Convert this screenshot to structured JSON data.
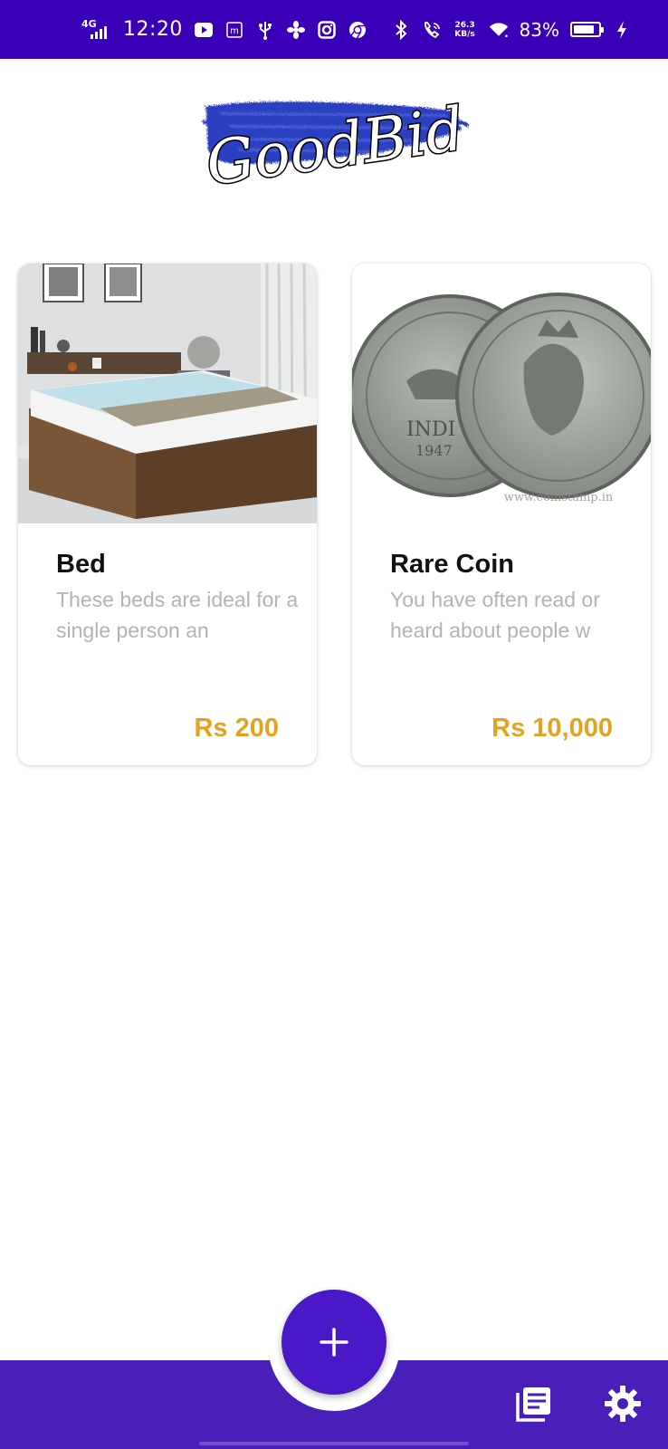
{
  "status_bar": {
    "network": "4G",
    "time": "12:20",
    "speed_value": "26.3",
    "speed_unit": "KB/s",
    "battery_percent": "83%",
    "battery_level": 0.83,
    "icons": [
      "youtube-icon",
      "m-app-icon",
      "usb-icon",
      "fan-icon",
      "instagram-icon",
      "chrome-icon",
      "bluetooth-icon",
      "wifi-calling-icon",
      "wifi-icon",
      "battery-icon",
      "charging-icon"
    ]
  },
  "logo": {
    "text": "GoodBid"
  },
  "listings": [
    {
      "title": "Bed",
      "description": "These beds are ideal for a single person an",
      "price": "Rs 200",
      "image": "bed-photo"
    },
    {
      "title": "Rare Coin",
      "description": "You have often read or heard about people w",
      "price": "Rs 10,000",
      "image": "coin-photo"
    }
  ],
  "bottom_nav": {
    "fab_icon": "plus-icon",
    "items_icon": "listings-icon",
    "settings_icon": "gear-icon"
  },
  "colors": {
    "status_bar": "#3a00b7",
    "bottom_bar": "#4a1eb8",
    "fab": "#4a18c6",
    "price": "#e6a21f",
    "description": "#b3b3b3",
    "logo_brush": "#2a3fc0"
  }
}
